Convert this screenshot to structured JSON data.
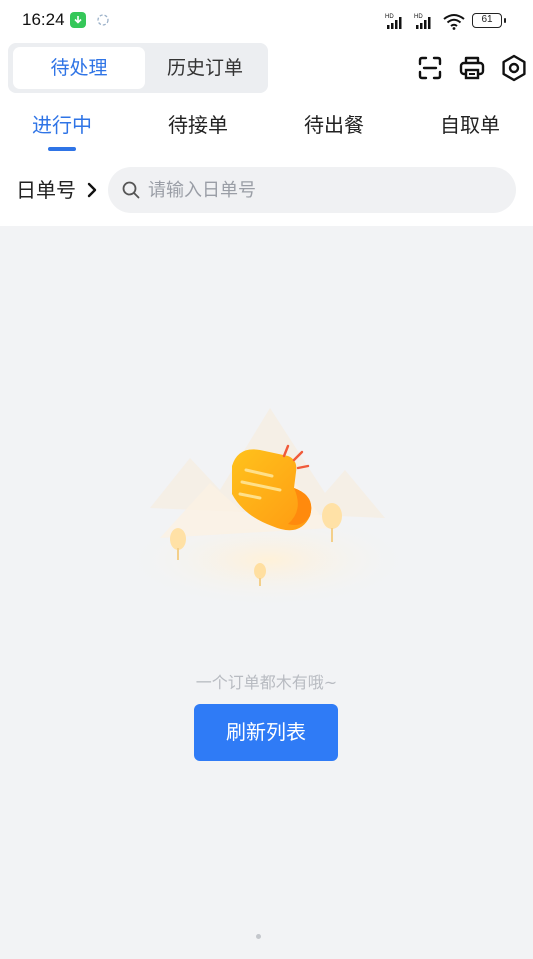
{
  "status_bar": {
    "time": "16:24",
    "battery": "61"
  },
  "header": {
    "tabs": [
      {
        "label": "待处理",
        "active": true
      },
      {
        "label": "历史订单",
        "active": false
      }
    ],
    "icons": [
      "scan-icon",
      "printer-icon",
      "settings-icon"
    ]
  },
  "status_tabs": [
    {
      "label": "进行中",
      "active": true
    },
    {
      "label": "待接单",
      "active": false
    },
    {
      "label": "待出餐",
      "active": false
    },
    {
      "label": "自取单",
      "active": false
    }
  ],
  "search": {
    "type_label": "日单号",
    "placeholder": "请输入日单号",
    "value": ""
  },
  "empty_state": {
    "message": "一个订单都木有哦~",
    "button_label": "刷新列表"
  },
  "colors": {
    "accent": "#2f74e6",
    "button": "#2f7bf6",
    "background": "#f2f3f5",
    "illustration_orange": "#ffb21c"
  }
}
